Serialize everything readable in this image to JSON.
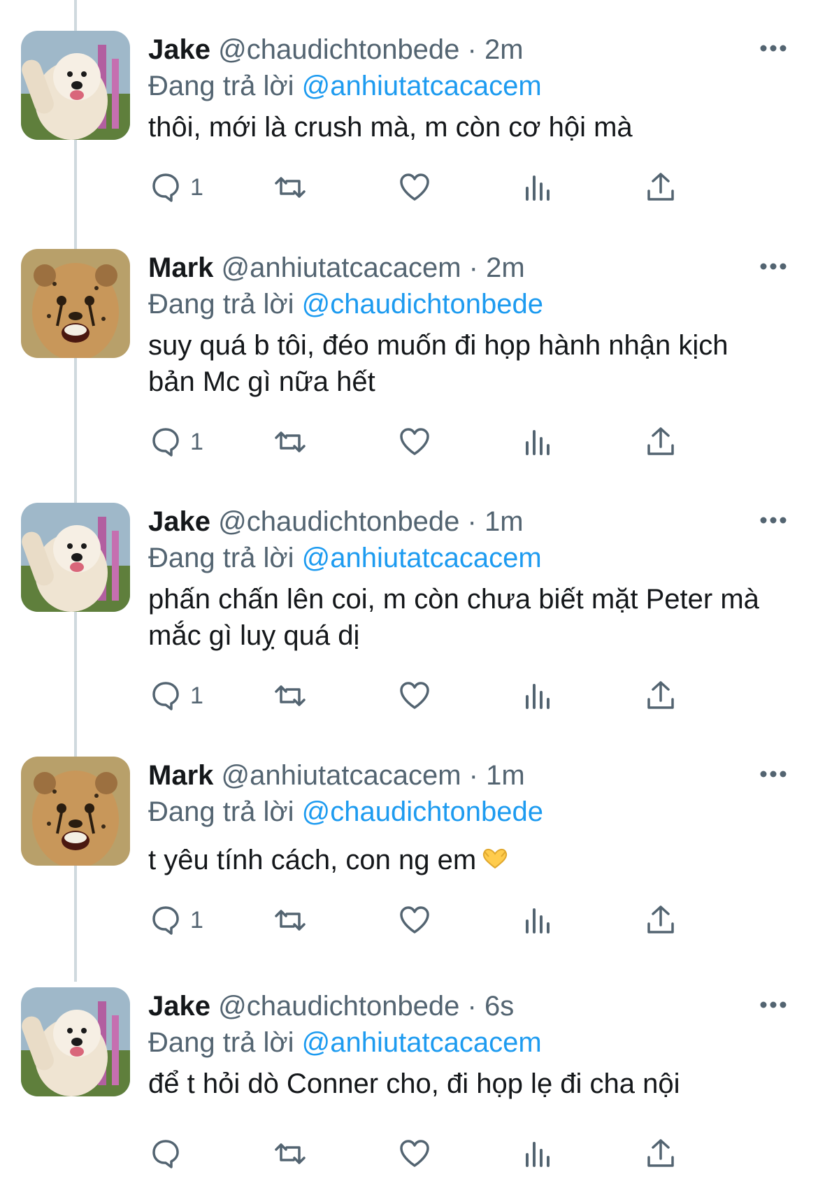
{
  "labels": {
    "replying_to": "Đang trả lời"
  },
  "colors": {
    "link": "#1d9bf0",
    "muted": "#536471",
    "thread_line": "#cfd9de"
  },
  "tweets": [
    {
      "avatar": "samoyed-dog-avatar",
      "name": "Jake",
      "handle": "@chaudichtonbede",
      "sep": "·",
      "time": "2m",
      "reply_to": "@anhiutatcacacem",
      "text": "thôi, mới là crush mà, m còn cơ hội mà",
      "reply_count": "1"
    },
    {
      "avatar": "cheetah-cub-avatar",
      "name": "Mark",
      "handle": "@anhiutatcacacem",
      "sep": "·",
      "time": "2m",
      "reply_to": "@chaudichtonbede",
      "text": "suy quá b tôi, đéo muốn đi họp hành nhận kịch bản Mc gì nữa hết",
      "reply_count": "1"
    },
    {
      "avatar": "samoyed-dog-avatar",
      "name": "Jake",
      "handle": "@chaudichtonbede",
      "sep": "·",
      "time": "1m",
      "reply_to": "@anhiutatcacacem",
      "text": "phấn chấn lên coi, m còn chưa biết mặt Peter mà mắc gì luỵ quá dị",
      "reply_count": "1"
    },
    {
      "avatar": "cheetah-cub-avatar",
      "name": "Mark",
      "handle": "@anhiutatcacacem",
      "sep": "·",
      "time": "1m",
      "reply_to": "@chaudichtonbede",
      "text": "t yêu tính cách, con ng em",
      "emoji": "heart-hands-emoji",
      "reply_count": "1"
    },
    {
      "avatar": "samoyed-dog-avatar",
      "name": "Jake",
      "handle": "@chaudichtonbede",
      "sep": "·",
      "time": "6s",
      "reply_to": "@anhiutatcacacem",
      "text": "để t hỏi dò Conner cho, đi họp lẹ đi cha nội",
      "reply_count": ""
    }
  ]
}
